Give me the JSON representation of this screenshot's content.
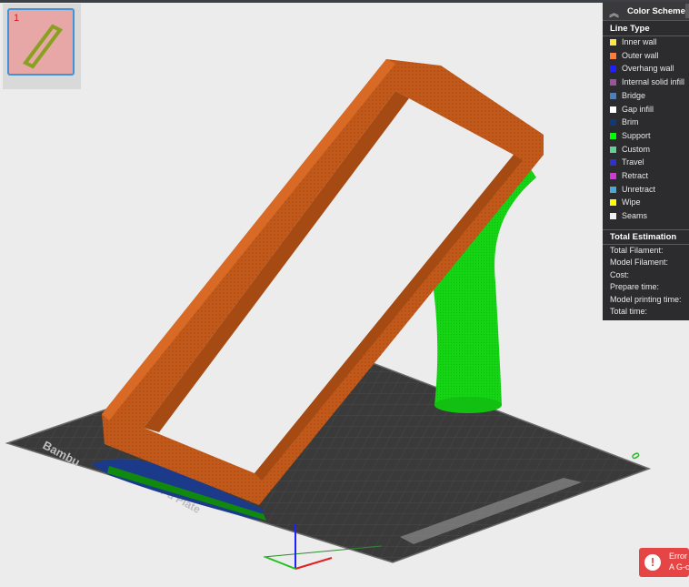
{
  "plate": {
    "number": "1"
  },
  "bed": {
    "label_rotation": "0",
    "brand_text": "Bambu",
    "sub_text": "Pd Plate"
  },
  "color_scheme": {
    "title": "Color Scheme",
    "line_type_title": "Line Type",
    "line_types": [
      {
        "label": "Inner wall",
        "color": "#ffe640"
      },
      {
        "label": "Outer wall",
        "color": "#ff7d38"
      },
      {
        "label": "Overhang wall",
        "color": "#1f1fff"
      },
      {
        "label": "Internal solid infill",
        "color": "#a050a0"
      },
      {
        "label": "Bridge",
        "color": "#4d80ba"
      },
      {
        "label": "Gap infill",
        "color": "#ffffff"
      },
      {
        "label": "Brim",
        "color": "#0a3a80"
      },
      {
        "label": "Support",
        "color": "#00ff00"
      },
      {
        "label": "Custom",
        "color": "#5ed194"
      },
      {
        "label": "Travel",
        "color": "#3030d0"
      },
      {
        "label": "Retract",
        "color": "#d03cd0"
      },
      {
        "label": "Unretract",
        "color": "#4aa8d6"
      },
      {
        "label": "Wipe",
        "color": "#ffff00"
      },
      {
        "label": "Seams",
        "color": "#f0f0f0"
      }
    ],
    "estimation_title": "Total Estimation",
    "estimation": [
      {
        "label": "Total Filament:"
      },
      {
        "label": "Model Filament:"
      },
      {
        "label": "Cost:"
      },
      {
        "label": "Prepare time:"
      },
      {
        "label": "Model printing time:"
      },
      {
        "label": "Total time:"
      }
    ]
  },
  "toast": {
    "line1": "Error",
    "line2": "A G-c"
  }
}
